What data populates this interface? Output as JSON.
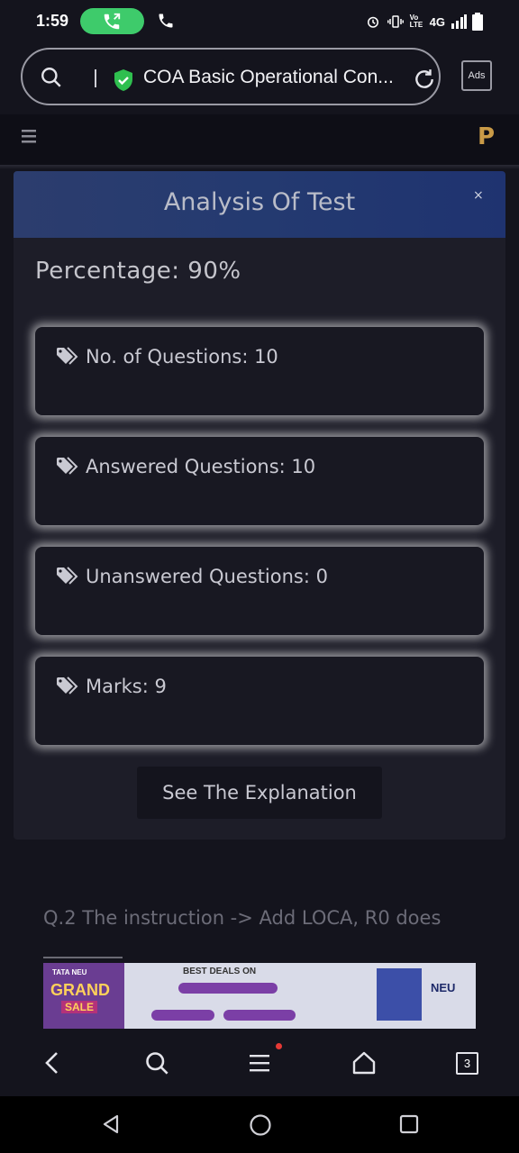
{
  "status_bar": {
    "time": "1:59",
    "network": "4G",
    "volte": "Vo LTE"
  },
  "browser": {
    "url_text": "COA Basic Operational Con...",
    "ads_label": "Ads",
    "tabs_count": "3"
  },
  "site": {
    "logo_letter": "P"
  },
  "modal": {
    "title": "Analysis Of Test",
    "close": "×",
    "percentage_label": "Percentage: 90%",
    "stats": [
      {
        "label": "No. of Questions: 10"
      },
      {
        "label": "Answered Questions: 10"
      },
      {
        "label": "Unanswered Questions: 0"
      },
      {
        "label": "Marks: 9"
      }
    ],
    "explanation_button": "See The Explanation"
  },
  "page": {
    "next_question": "Q.2 The instruction -> Add LOCA, R0 does"
  },
  "ad": {
    "brand": "TATA NEU",
    "grand": "GRAND",
    "sale": "SALE",
    "deals": "BEST DEALS ON",
    "neu": "NEU"
  },
  "colors": {
    "background": "#14141d",
    "modal_header": "#243a70",
    "card_glow": "#ffffff",
    "logo": "#c99a47",
    "call_pill": "#3ecb6b"
  }
}
